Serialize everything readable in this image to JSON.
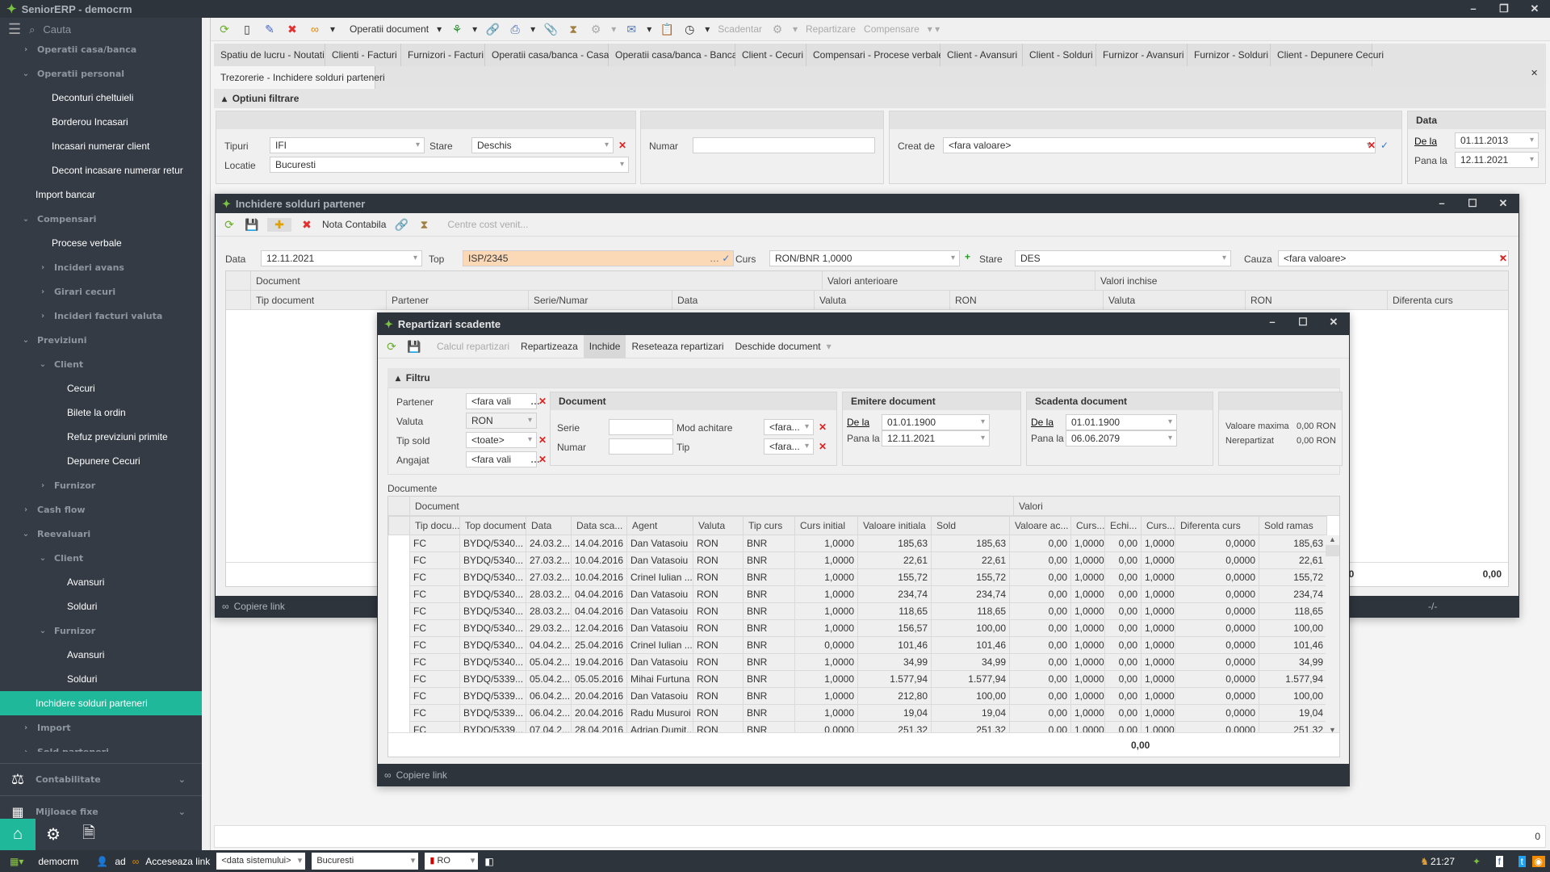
{
  "app": {
    "title": "SeniorERP - democrm",
    "search_placeholder": "Cauta"
  },
  "sidebar": {
    "items": [
      {
        "label": "Operatii casa/banca",
        "level": 1,
        "kind": "closed"
      },
      {
        "label": "Operatii personal",
        "level": 1,
        "kind": "open"
      },
      {
        "label": "Deconturi cheltuieli",
        "level": 2,
        "kind": "leaf"
      },
      {
        "label": "Borderou Incasari",
        "level": 2,
        "kind": "leaf"
      },
      {
        "label": "Incasari numerar client",
        "level": 2,
        "kind": "leaf"
      },
      {
        "label": "Decont incasare numerar retur",
        "level": 2,
        "kind": "leaf"
      },
      {
        "label": "Import bancar",
        "level": 1,
        "kind": "leaf"
      },
      {
        "label": "Compensari",
        "level": 1,
        "kind": "open"
      },
      {
        "label": "Procese verbale",
        "level": 2,
        "kind": "leaf"
      },
      {
        "label": "Incideri avans",
        "level": 2,
        "kind": "closed"
      },
      {
        "label": "Girari cecuri",
        "level": 2,
        "kind": "closed"
      },
      {
        "label": "Incideri facturi valuta",
        "level": 2,
        "kind": "closed"
      },
      {
        "label": "Previziuni",
        "level": 1,
        "kind": "open"
      },
      {
        "label": "Client",
        "level": 2,
        "kind": "open"
      },
      {
        "label": "Cecuri",
        "level": 3,
        "kind": "leaf"
      },
      {
        "label": "Bilete la ordin",
        "level": 3,
        "kind": "leaf"
      },
      {
        "label": "Refuz previziuni primite",
        "level": 3,
        "kind": "leaf"
      },
      {
        "label": "Depunere Cecuri",
        "level": 3,
        "kind": "leaf"
      },
      {
        "label": "Furnizor",
        "level": 2,
        "kind": "closed"
      },
      {
        "label": "Cash flow",
        "level": 1,
        "kind": "closed"
      },
      {
        "label": "Reevaluari",
        "level": 1,
        "kind": "open"
      },
      {
        "label": "Client",
        "level": 2,
        "kind": "open"
      },
      {
        "label": "Avansuri",
        "level": 3,
        "kind": "leaf"
      },
      {
        "label": "Solduri",
        "level": 3,
        "kind": "leaf"
      },
      {
        "label": "Furnizor",
        "level": 2,
        "kind": "open"
      },
      {
        "label": "Avansuri",
        "level": 3,
        "kind": "leaf"
      },
      {
        "label": "Solduri",
        "level": 3,
        "kind": "leaf"
      },
      {
        "label": "Inchidere solduri parteneri",
        "level": 1,
        "kind": "leaf",
        "selected": true
      },
      {
        "label": "Import",
        "level": 1,
        "kind": "closed"
      },
      {
        "label": "Sold parteneri",
        "level": 1,
        "kind": "closed"
      }
    ],
    "sections": [
      {
        "label": "Contabilitate",
        "icon": "scales-icon"
      },
      {
        "label": "Mijloace fixe",
        "icon": "building-icon"
      }
    ]
  },
  "toolbar": {
    "operatii": "Operatii document",
    "scadentar": "Scadentar",
    "repartizare": "Repartizare",
    "compensare": "Compensare"
  },
  "tabs": [
    "Spatiu de lucru - Noutati",
    "Clienti - Facturi",
    "Furnizori - Facturi",
    "Operatii casa/banca - Casa",
    "Operatii casa/banca - Banca",
    "Client - Cecuri",
    "Compensari - Procese verbale",
    "Client - Avansuri",
    "Client - Solduri",
    "Furnizor - Avansuri",
    "Furnizor - Solduri",
    "Client - Depunere Cecuri",
    "Trezorerie - Inchidere solduri parteneri"
  ],
  "filter": {
    "title": "Optiuni filtrare",
    "tipuri_label": "Tipuri",
    "tipuri": "IFI",
    "stare_label": "Stare",
    "stare": "Deschis",
    "locatie_label": "Locatie",
    "locatie": "Bucuresti",
    "numar_label": "Numar",
    "numar": "",
    "creat_label": "Creat de",
    "creat": "<fara valoare>",
    "data_title": "Data",
    "dela_label": "De la",
    "dela": "01.11.2013",
    "panala_label": "Pana la",
    "panala": "12.11.2021"
  },
  "inchidere": {
    "title": "Inchidere solduri partener",
    "nota": "Nota Contabila",
    "centre": "Centre cost venit...",
    "data_label": "Data",
    "data": "12.11.2021",
    "top_label": "Top",
    "top": "ISP/2345",
    "curs_label": "Curs",
    "curs": "RON/BNR 1,0000",
    "stare_label": "Stare",
    "stare": "DES",
    "cauza_label": "Cauza",
    "cauza": "<fara valoare>",
    "groups": [
      "Document",
      "Valori anterioare",
      "Valori inchise"
    ],
    "columns": [
      "Tip document",
      "Partener",
      "Serie/Numar",
      "Data",
      "Valuta",
      "RON",
      "Valuta",
      "RON",
      "Diferenta curs"
    ],
    "total1": "00",
    "total2": "0,00",
    "copy": "Copiere link",
    "pager": "-/-"
  },
  "repartizari": {
    "title": "Repartizari scadente",
    "calc": "Calcul repartizari",
    "repartizeaza": "Repartizeaza",
    "inchide": "Inchide",
    "reseteaza": "Reseteaza repartizari",
    "deschide": "Deschide document",
    "filtru": "Filtru",
    "partener_label": "Partener",
    "partener": "<fara vali",
    "valuta_label": "Valuta",
    "valuta": "RON",
    "tipsold_label": "Tip sold",
    "tipsold": "<toate>",
    "angajat_label": "Angajat",
    "angajat": "<fara vali",
    "doc_title": "Document",
    "serie_label": "Serie",
    "numar_label": "Numar",
    "mod_label": "Mod achitare",
    "mod": "<fara...",
    "tip_label": "Tip",
    "tip": "<fara...",
    "emit_title": "Emitere document",
    "emit_dela_label": "De la",
    "emit_dela": "01.01.1900",
    "emit_pana_label": "Pana la",
    "emit_pana": "12.11.2021",
    "scad_title": "Scadenta document",
    "scad_dela_label": "De la",
    "scad_dela": "01.01.1900",
    "scad_pana_label": "Pana la",
    "scad_pana": "06.06.2079",
    "valmax_label": "Valoare maxima",
    "valmax": "0,00 RON",
    "nerep_label": "Nerepartizat",
    "nerep": "0,00 RON",
    "documente": "Documente",
    "group_doc": "Document",
    "group_val": "Valori",
    "columns": [
      "Tip docu...",
      "Top document",
      "Data",
      "Data sca...",
      "Agent",
      "Valuta",
      "Tip curs",
      "Curs initial",
      "Valoare initiala",
      "Sold",
      "Valoare ac...",
      "Curs...",
      "Echi...",
      "Curs...",
      "Diferenta curs",
      "Sold ramas"
    ],
    "rows": [
      [
        "FC",
        "BYDQ/5340...",
        "24.03.2...",
        "14.04.2016",
        "Dan  Vatasoiu",
        "RON",
        "BNR",
        "1,0000",
        "185,63",
        "185,63",
        "0,00",
        "1,0000",
        "0,00",
        "1,0000",
        "0,0000",
        "185,63"
      ],
      [
        "FC",
        "BYDQ/5340...",
        "27.03.2...",
        "10.04.2016",
        "Dan  Vatasoiu",
        "RON",
        "BNR",
        "1,0000",
        "22,61",
        "22,61",
        "0,00",
        "1,0000",
        "0,00",
        "1,0000",
        "0,0000",
        "22,61"
      ],
      [
        "FC",
        "BYDQ/5340...",
        "27.03.2...",
        "10.04.2016",
        "Crinel Iulian ...",
        "RON",
        "BNR",
        "1,0000",
        "155,72",
        "155,72",
        "0,00",
        "1,0000",
        "0,00",
        "1,0000",
        "0,0000",
        "155,72"
      ],
      [
        "FC",
        "BYDQ/5340...",
        "28.03.2...",
        "04.04.2016",
        "Dan  Vatasoiu",
        "RON",
        "BNR",
        "1,0000",
        "234,74",
        "234,74",
        "0,00",
        "1,0000",
        "0,00",
        "1,0000",
        "0,0000",
        "234,74"
      ],
      [
        "FC",
        "BYDQ/5340...",
        "28.03.2...",
        "04.04.2016",
        "Dan  Vatasoiu",
        "RON",
        "BNR",
        "1,0000",
        "118,65",
        "118,65",
        "0,00",
        "1,0000",
        "0,00",
        "1,0000",
        "0,0000",
        "118,65"
      ],
      [
        "FC",
        "BYDQ/5340...",
        "29.03.2...",
        "12.04.2016",
        "Dan  Vatasoiu",
        "RON",
        "BNR",
        "1,0000",
        "156,57",
        "100,00",
        "0,00",
        "1,0000",
        "0,00",
        "1,0000",
        "0,0000",
        "100,00"
      ],
      [
        "FC",
        "BYDQ/5340...",
        "04.04.2...",
        "25.04.2016",
        "Crinel Iulian ...",
        "RON",
        "BNR",
        "0,0000",
        "101,46",
        "101,46",
        "0,00",
        "1,0000",
        "0,00",
        "1,0000",
        "0,0000",
        "101,46"
      ],
      [
        "FC",
        "BYDQ/5340...",
        "05.04.2...",
        "19.04.2016",
        "Dan  Vatasoiu",
        "RON",
        "BNR",
        "1,0000",
        "34,99",
        "34,99",
        "0,00",
        "1,0000",
        "0,00",
        "1,0000",
        "0,0000",
        "34,99"
      ],
      [
        "FC",
        "BYDQ/5339...",
        "05.04.2...",
        "05.05.2016",
        "Mihai Furtuna",
        "RON",
        "BNR",
        "1,0000",
        "1.577,94",
        "1.577,94",
        "0,00",
        "1,0000",
        "0,00",
        "1,0000",
        "0,0000",
        "1.577,94"
      ],
      [
        "FC",
        "BYDQ/5339...",
        "06.04.2...",
        "20.04.2016",
        "Dan  Vatasoiu",
        "RON",
        "BNR",
        "1,0000",
        "212,80",
        "100,00",
        "0,00",
        "1,0000",
        "0,00",
        "1,0000",
        "0,0000",
        "100,00"
      ],
      [
        "FC",
        "BYDQ/5339...",
        "06.04.2...",
        "20.04.2016",
        "Radu Musuroi",
        "RON",
        "BNR",
        "1,0000",
        "19,04",
        "19,04",
        "0,00",
        "1,0000",
        "0,00",
        "1,0000",
        "0,0000",
        "19,04"
      ],
      [
        "FC",
        "BYDQ/5339...",
        "07.04.2...",
        "28.04.2016",
        "Adrian  Dumit...",
        "RON",
        "BNR",
        "0,0000",
        "251,32",
        "251,32",
        "0,00",
        "1,0000",
        "0,00",
        "1,0000",
        "0,0000",
        "251,32"
      ]
    ],
    "total": "0,00",
    "copy": "Copiere link"
  },
  "status": {
    "count": "0"
  },
  "taskbar": {
    "db": "democrm",
    "user": "ad",
    "link": "Acceseaza link",
    "date": "<data sistemului>",
    "location": "Bucuresti",
    "lang": "RO",
    "time": "21:27"
  },
  "colors": {
    "sidebar": "#343b45",
    "accent": "#1fb89a",
    "titlebar": "#2e343c",
    "highlight_field": "#fcd9b6"
  }
}
